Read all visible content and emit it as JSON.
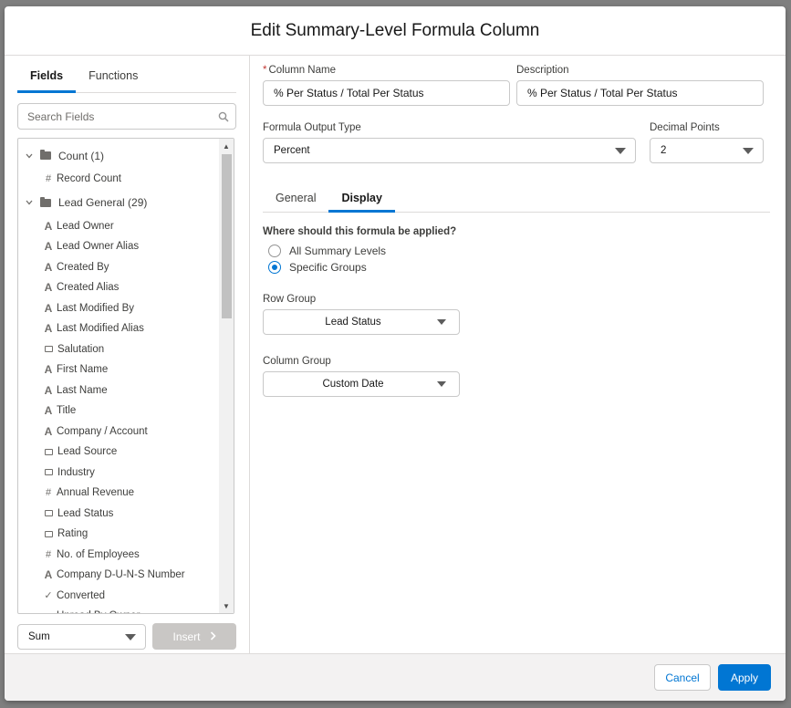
{
  "dialog": {
    "title": "Edit Summary-Level Formula Column"
  },
  "left_tabs": [
    {
      "label": "Fields",
      "active": true
    },
    {
      "label": "Functions",
      "active": false
    }
  ],
  "search": {
    "placeholder": "Search Fields",
    "value": ""
  },
  "tree": {
    "groups": [
      {
        "label": "Count (1)",
        "fields": [
          {
            "label": "Record Count",
            "type": "number",
            "glyph": "#"
          }
        ]
      },
      {
        "label": "Lead General (29)",
        "fields": [
          {
            "label": "Lead Owner",
            "type": "text",
            "glyph": "A"
          },
          {
            "label": "Lead Owner Alias",
            "type": "text",
            "glyph": "A"
          },
          {
            "label": "Created By",
            "type": "text",
            "glyph": "A"
          },
          {
            "label": "Created Alias",
            "type": "text",
            "glyph": "A"
          },
          {
            "label": "Last Modified By",
            "type": "text",
            "glyph": "A"
          },
          {
            "label": "Last Modified Alias",
            "type": "text",
            "glyph": "A"
          },
          {
            "label": "Salutation",
            "type": "picklist",
            "glyph": ""
          },
          {
            "label": "First Name",
            "type": "text",
            "glyph": "A"
          },
          {
            "label": "Last Name",
            "type": "text",
            "glyph": "A"
          },
          {
            "label": "Title",
            "type": "text",
            "glyph": "A"
          },
          {
            "label": "Company / Account",
            "type": "text",
            "glyph": "A"
          },
          {
            "label": "Lead Source",
            "type": "picklist",
            "glyph": ""
          },
          {
            "label": "Industry",
            "type": "picklist",
            "glyph": ""
          },
          {
            "label": "Annual Revenue",
            "type": "number",
            "glyph": "#"
          },
          {
            "label": "Lead Status",
            "type": "picklist",
            "glyph": ""
          },
          {
            "label": "Rating",
            "type": "picklist",
            "glyph": ""
          },
          {
            "label": "No. of Employees",
            "type": "number",
            "glyph": "#"
          },
          {
            "label": "Company D-U-N-S Number",
            "type": "text",
            "glyph": "A"
          },
          {
            "label": "Converted",
            "type": "checkbox",
            "glyph": "✓"
          },
          {
            "label": "Unread By Owner",
            "type": "checkbox",
            "glyph": "✓"
          }
        ]
      }
    ]
  },
  "aggregate": {
    "value": "Sum"
  },
  "insert_button": {
    "label": "Insert"
  },
  "form": {
    "column_name": {
      "label": "Column Name",
      "required_mark": "*",
      "value": "% Per Status / Total Per Status"
    },
    "description": {
      "label": "Description",
      "value": "% Per Status / Total Per Status"
    },
    "output_type": {
      "label": "Formula Output Type",
      "value": "Percent"
    },
    "decimal_points": {
      "label": "Decimal Points",
      "value": "2"
    }
  },
  "right_tabs": [
    {
      "label": "General",
      "active": false
    },
    {
      "label": "Display",
      "active": true
    }
  ],
  "display": {
    "question": "Where should this formula be applied?",
    "options": [
      {
        "label": "All Summary Levels",
        "checked": false
      },
      {
        "label": "Specific Groups",
        "checked": true
      }
    ],
    "row_group": {
      "label": "Row Group",
      "value": "Lead Status"
    },
    "column_group": {
      "label": "Column Group",
      "value": "Custom Date"
    }
  },
  "footer": {
    "cancel_label": "Cancel",
    "apply_label": "Apply"
  },
  "colors": {
    "brand": "#0176d3",
    "required": "#c23934",
    "disabled_button": "#c9c7c5"
  }
}
